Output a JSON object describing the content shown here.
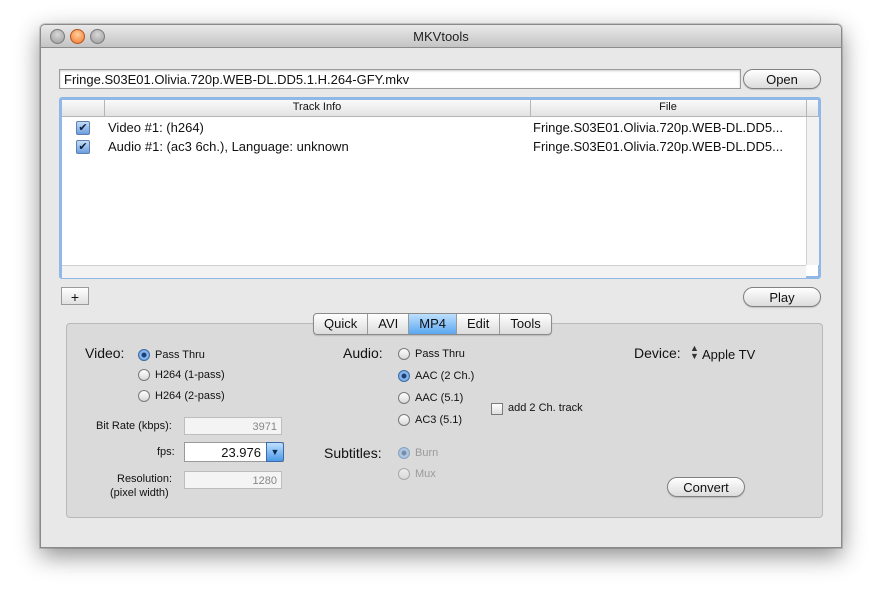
{
  "window": {
    "title": "MKVtools"
  },
  "file": {
    "path": "Fringe.S03E01.Olivia.720p.WEB-DL.DD5.1.H.264-GFY.mkv",
    "open_label": "Open"
  },
  "tracks": {
    "headers": [
      "Track Info",
      "File"
    ],
    "rows": [
      {
        "checked": true,
        "info": "Video #1:  (h264)",
        "file": "Fringe.S03E01.Olivia.720p.WEB-DL.DD5..."
      },
      {
        "checked": true,
        "info": "Audio #1:  (ac3  6ch.),    Language: unknown",
        "file": "Fringe.S03E01.Olivia.720p.WEB-DL.DD5..."
      }
    ]
  },
  "add_label": "+",
  "play_label": "Play",
  "tabs": [
    "Quick",
    "AVI",
    "MP4",
    "Edit",
    "Tools"
  ],
  "active_tab": "MP4",
  "video": {
    "label": "Video:",
    "options": [
      "Pass Thru",
      "H264 (1-pass)",
      "H264 (2-pass)"
    ],
    "selected": "Pass Thru",
    "bitrate_label": "Bit Rate (kbps):",
    "bitrate_value": "3971",
    "fps_label": "fps:",
    "fps_value": "23.976",
    "resolution_label": "Resolution:",
    "resolution_sub": "(pixel width)",
    "resolution_value": "1280"
  },
  "audio": {
    "label": "Audio:",
    "options": [
      "Pass Thru",
      "AAC (2 Ch.)",
      "AAC (5.1)",
      "AC3 (5.1)"
    ],
    "selected": "AAC (2 Ch.)",
    "add_track_label": "add 2 Ch. track"
  },
  "subtitles": {
    "label": "Subtitles:",
    "options": [
      "Burn",
      "Mux"
    ],
    "selected": "Burn"
  },
  "device": {
    "label": "Device:",
    "value": "Apple TV"
  },
  "convert_label": "Convert"
}
